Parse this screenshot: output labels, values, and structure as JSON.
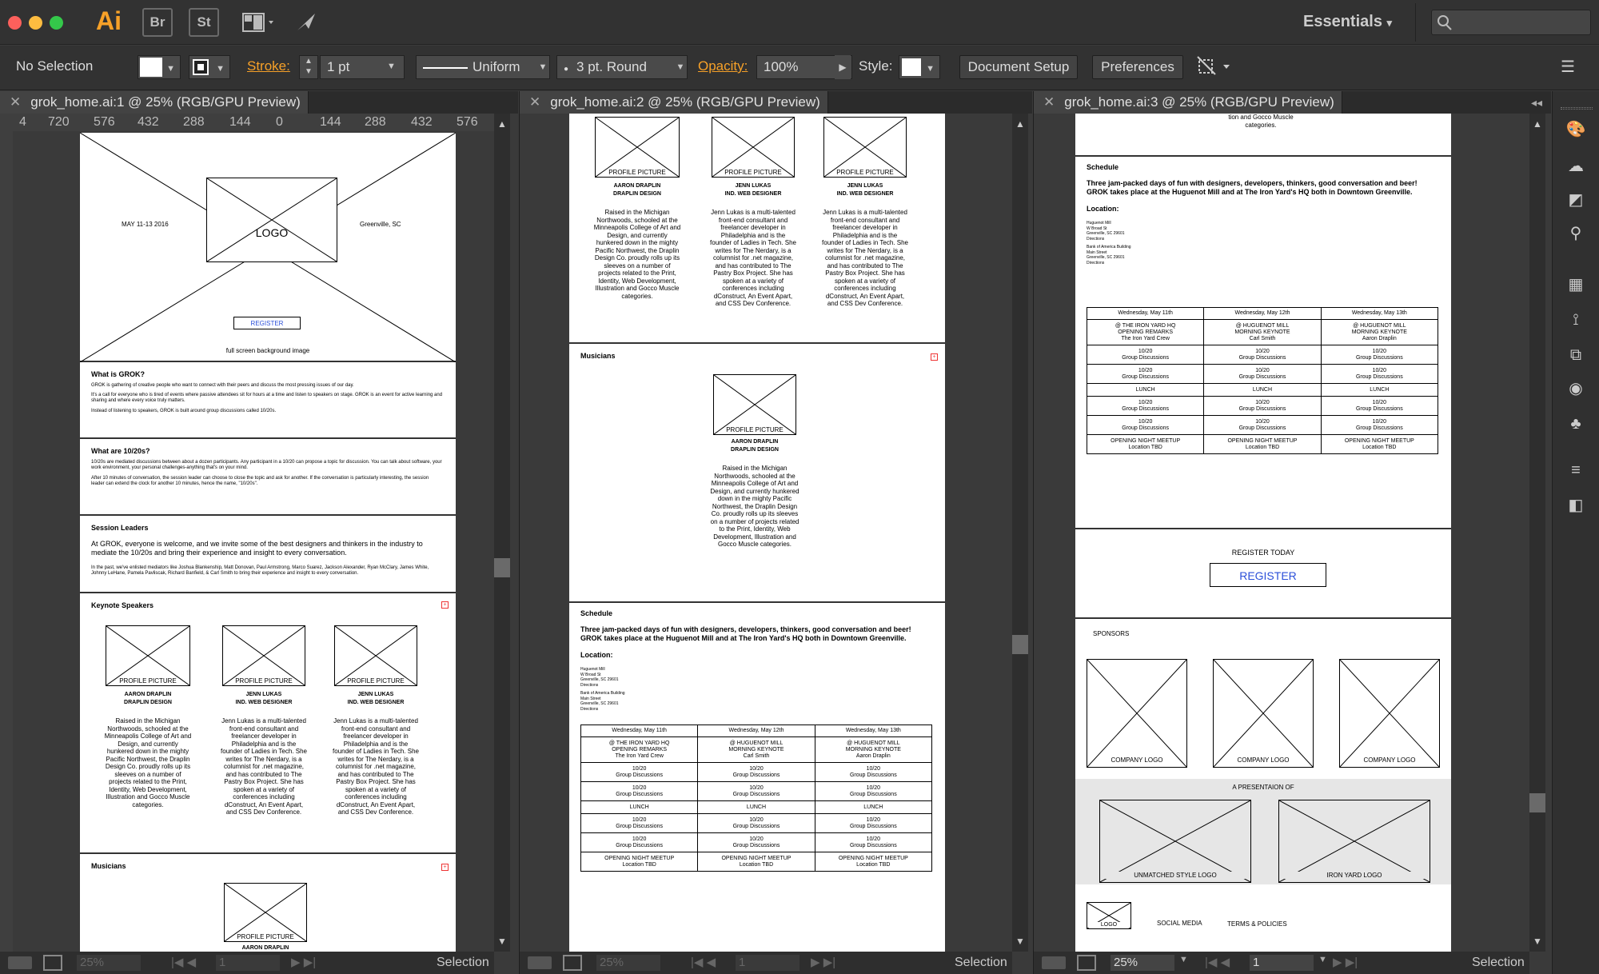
{
  "app": {
    "logo": "Ai",
    "bridge": "Br",
    "stock": "St",
    "workspace": "Essentials"
  },
  "control": {
    "selection": "No Selection",
    "stroke_label": "Stroke:",
    "stroke_weight": "1 pt",
    "profile": "Uniform",
    "brush": "3 pt. Round",
    "opacity_label": "Opacity:",
    "opacity_value": "100%",
    "style_label": "Style:",
    "document_setup": "Document Setup",
    "preferences": "Preferences"
  },
  "docs": [
    {
      "tab": "grok_home.ai:1 @ 25% (RGB/GPU Preview)",
      "zoom": "25%",
      "page": "1",
      "status": "Selection"
    },
    {
      "tab": "grok_home.ai:2 @ 25% (RGB/GPU Preview)",
      "zoom": "25%",
      "page": "1",
      "status": "Selection"
    },
    {
      "tab": "grok_home.ai:3 @ 25% (RGB/GPU Preview)",
      "zoom": "25%",
      "page": "1",
      "status": "Selection"
    }
  ],
  "ruler_marks": [
    "4",
    "720",
    "576",
    "432",
    "288",
    "144",
    "0",
    "144",
    "288",
    "432",
    "576"
  ],
  "wire": {
    "date": "MAY 11-13 2016",
    "city": "Greenville, SC",
    "logo": "LOGO",
    "register": "REGISTER",
    "bg_caption": "full screen background image",
    "what_grok_title": "What is GROK?",
    "what_grok_p1": "GROK is gathering of creative people who want to connect with their peers and discuss the most pressing issues of our day.",
    "what_grok_p2": "It's a call for everyone who is tired of events where passive attendees sit for hours at a time and listen to speakers on stage. GROK is an event for active learning and sharing and where every voice truly matters.",
    "what_grok_p3": "Instead of listening to speakers, GROK is built around group discussions called 10/20s.",
    "what_1020_title": "What are 10/20s?",
    "what_1020_p1": "10/20s are mediated discussions between about a dozen participants. Any participant in a 10/20 can propose a topic for discussion. You can talk about software, your work environment, your personal challenges-anything that's on your mind.",
    "what_1020_p2": "After 10 minutes of conversation, the session leader can choose to close the topic and ask for another. If the conversation is particularly interesting, the session leader can extend the clock for another 10 minutes, hence the name, \"10/20s\".",
    "leaders_title": "Session Leaders",
    "leaders_p1": "At GROK, everyone is welcome, and we invite some of the best designers and thinkers in the industry to mediate the 10/20s and bring their experience and insight to every conversation.",
    "leaders_p2": "In the past, we've enlisted mediators like Joshua Blankenship, Matt Donovan, Paul Armstrong, Marco Suarez, Jackson Alexander, Ryan McClary, James White, Johnny LeHane, Pamela Pavliscak, Richard Banfield, & Carl Smith to bring their experience and insight to every conversation.",
    "keynote_title": "Keynote Speakers",
    "profile_picture": "PROFILE PICTURE",
    "speakers": [
      {
        "name": "AARON DRAPLIN",
        "role": "DRAPLIN DESIGN",
        "bio": "Raised in the Michigan Northwoods, schooled at the Minneapolis College of Art and Design, and currently hunkered down in the mighty Pacific Northwest, the Draplin Design Co. proudly rolls up its sleeves on a number of projects related to the Print, Identity, Web Development, Illustration and Gocco Muscle categories."
      },
      {
        "name": "JENN LUKAS",
        "role": "IND. WEB DESIGNER",
        "bio": "Jenn Lukas is a multi-talented front-end consultant and freelancer developer in Philadelphia and is the founder of Ladies in Tech. She writes for The Nerdary, is a columnist for .net magazine, and has contributed to The Pastry Box Project. She has spoken at a variety of conferences including dConstruct, An Event Apart, and CSS Dev Conference."
      },
      {
        "name": "JENN LUKAS",
        "role": "IND. WEB DESIGNER",
        "bio": "Jenn Lukas is a multi-talented front-end consultant and freelancer developer in Philadelphia and is the founder of Ladies in Tech. She writes for The Nerdary, is a columnist for .net magazine, and has contributed to The Pastry Box Project. She has spoken at a variety of conferences including dConstruct, An Event Apart, and CSS Dev Conference."
      }
    ],
    "musicians_title": "Musicians",
    "musician_cut_name": "AARON DRAPLIN",
    "schedule_title": "Schedule",
    "schedule_intro": "Three jam-packed days of fun with designers, developers, thinkers, good conversation and beer! GROK takes place at the Huguenot Mill and at The Iron Yard's HQ both in Downtown Greenville.",
    "location_title": "Location:",
    "location_1": [
      "Huguenot Mill",
      "W Broad St",
      "Greenville, SC 29601",
      "Directions"
    ],
    "location_2": [
      "Bank of America Building",
      "Main Street",
      "Greenville, SC 29601",
      "Directions"
    ],
    "schedule_days": [
      "Wednesday, May 11th",
      "Wednesday, May 12th",
      "Wednesday, May 13th"
    ],
    "schedule_rows": [
      [
        "@ THE IRON YARD HQ\nOPENING REMARKS\nThe Iron Yard Crew",
        "@ HUGUENOT MILL\nMORNING KEYNOTE\nCarl Smith",
        "@ HUGUENOT MILL\nMORNING KEYNOTE\nAaron Draplin"
      ],
      [
        "10/20\nGroup Discussions",
        "10/20\nGroup Discussions",
        "10/20\nGroup Discussions"
      ],
      [
        "10/20\nGroup Discussions",
        "10/20\nGroup Discussions",
        "10/20\nGroup Discussions"
      ],
      [
        "LUNCH",
        "LUNCH",
        "LUNCH"
      ],
      [
        "10/20\nGroup Discussions",
        "10/20\nGroup Discussions",
        "10/20\nGroup Discussions"
      ],
      [
        "10/20\nGroup Discussions",
        "10/20\nGroup Discussions",
        "10/20\nGroup Discussions"
      ],
      [
        "OPENING NIGHT MEETUP\nLocation TBD",
        "OPENING NIGHT MEETUP\nLocation TBD",
        "OPENING NIGHT MEETUP\nLocation TBD"
      ]
    ],
    "cut_bio_end": "tion and Gocco Muscle categories.",
    "register_today": "REGISTER TODAY",
    "register_btn": "REGISTER",
    "sponsors": "SPONSORS",
    "company_logo": "COMPANY LOGO",
    "presentation_of": "A PRESENTAION OF",
    "unmatched_logo": "UNMATCHED STYLE LOGO",
    "iron_yard_logo": "IRON YARD LOGO",
    "footer_logo": "LOGO",
    "social_media": "SOCIAL MEDIA",
    "terms": "TERMS & POLICIES"
  }
}
